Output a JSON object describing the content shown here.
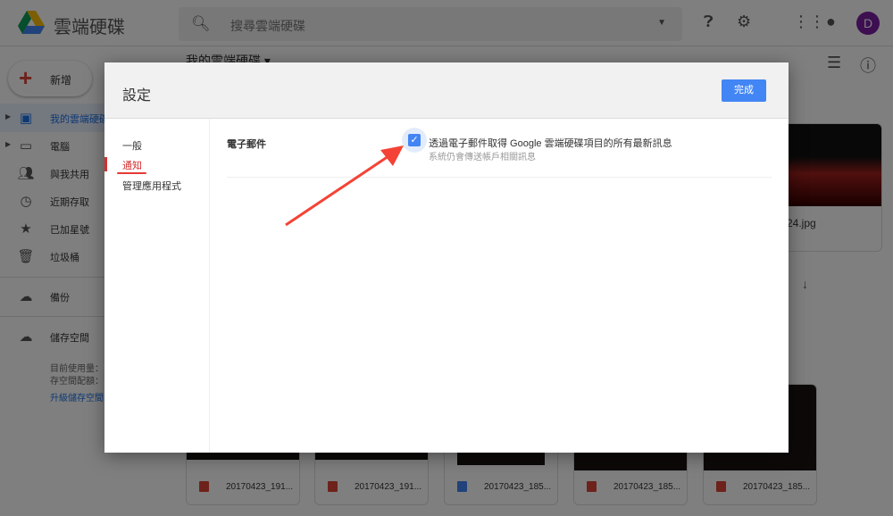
{
  "app": {
    "title": "雲端硬碟",
    "search_placeholder": "搜尋雲端硬碟",
    "avatar_letter": "D"
  },
  "sidebar": {
    "new_label": "新增",
    "items": [
      {
        "label": "我的雲端硬碟",
        "icon": "drive-icon"
      },
      {
        "label": "電腦",
        "icon": "computer-icon"
      },
      {
        "label": "與我共用",
        "icon": "people-icon"
      },
      {
        "label": "近期存取",
        "icon": "clock-icon"
      },
      {
        "label": "已加星號",
        "icon": "star-icon"
      },
      {
        "label": "垃圾桶",
        "icon": "trash-icon"
      }
    ],
    "backup_label": "備份",
    "storage_label": "儲存空間",
    "storage_used": "目前使用量：",
    "storage_quota": "存空間配額：",
    "upgrade_label": "升級儲存空間"
  },
  "main": {
    "breadcrumb": "我的雲端硬碟",
    "top_file": {
      "name": "24.jpg"
    },
    "files": [
      {
        "name": "20170423_191...",
        "type": "image"
      },
      {
        "name": "20170423_191...",
        "type": "image"
      },
      {
        "name": "20170423_185...",
        "type": "doc"
      },
      {
        "name": "20170423_185...",
        "type": "image"
      },
      {
        "name": "20170423_185...",
        "type": "image"
      }
    ]
  },
  "dialog": {
    "title": "設定",
    "done_label": "完成",
    "nav": [
      "一般",
      "通知",
      "管理應用程式"
    ],
    "section_label": "電子郵件",
    "option_label": "透過電子郵件取得 Google 雲端硬碟項目的所有最新訊息",
    "option_sub": "系統仍會傳送帳戶相關訊息",
    "option_checked": true
  },
  "colors": {
    "accent": "#4285f4",
    "selected_nav": "#d32f2f",
    "annotation": "#f44336"
  }
}
